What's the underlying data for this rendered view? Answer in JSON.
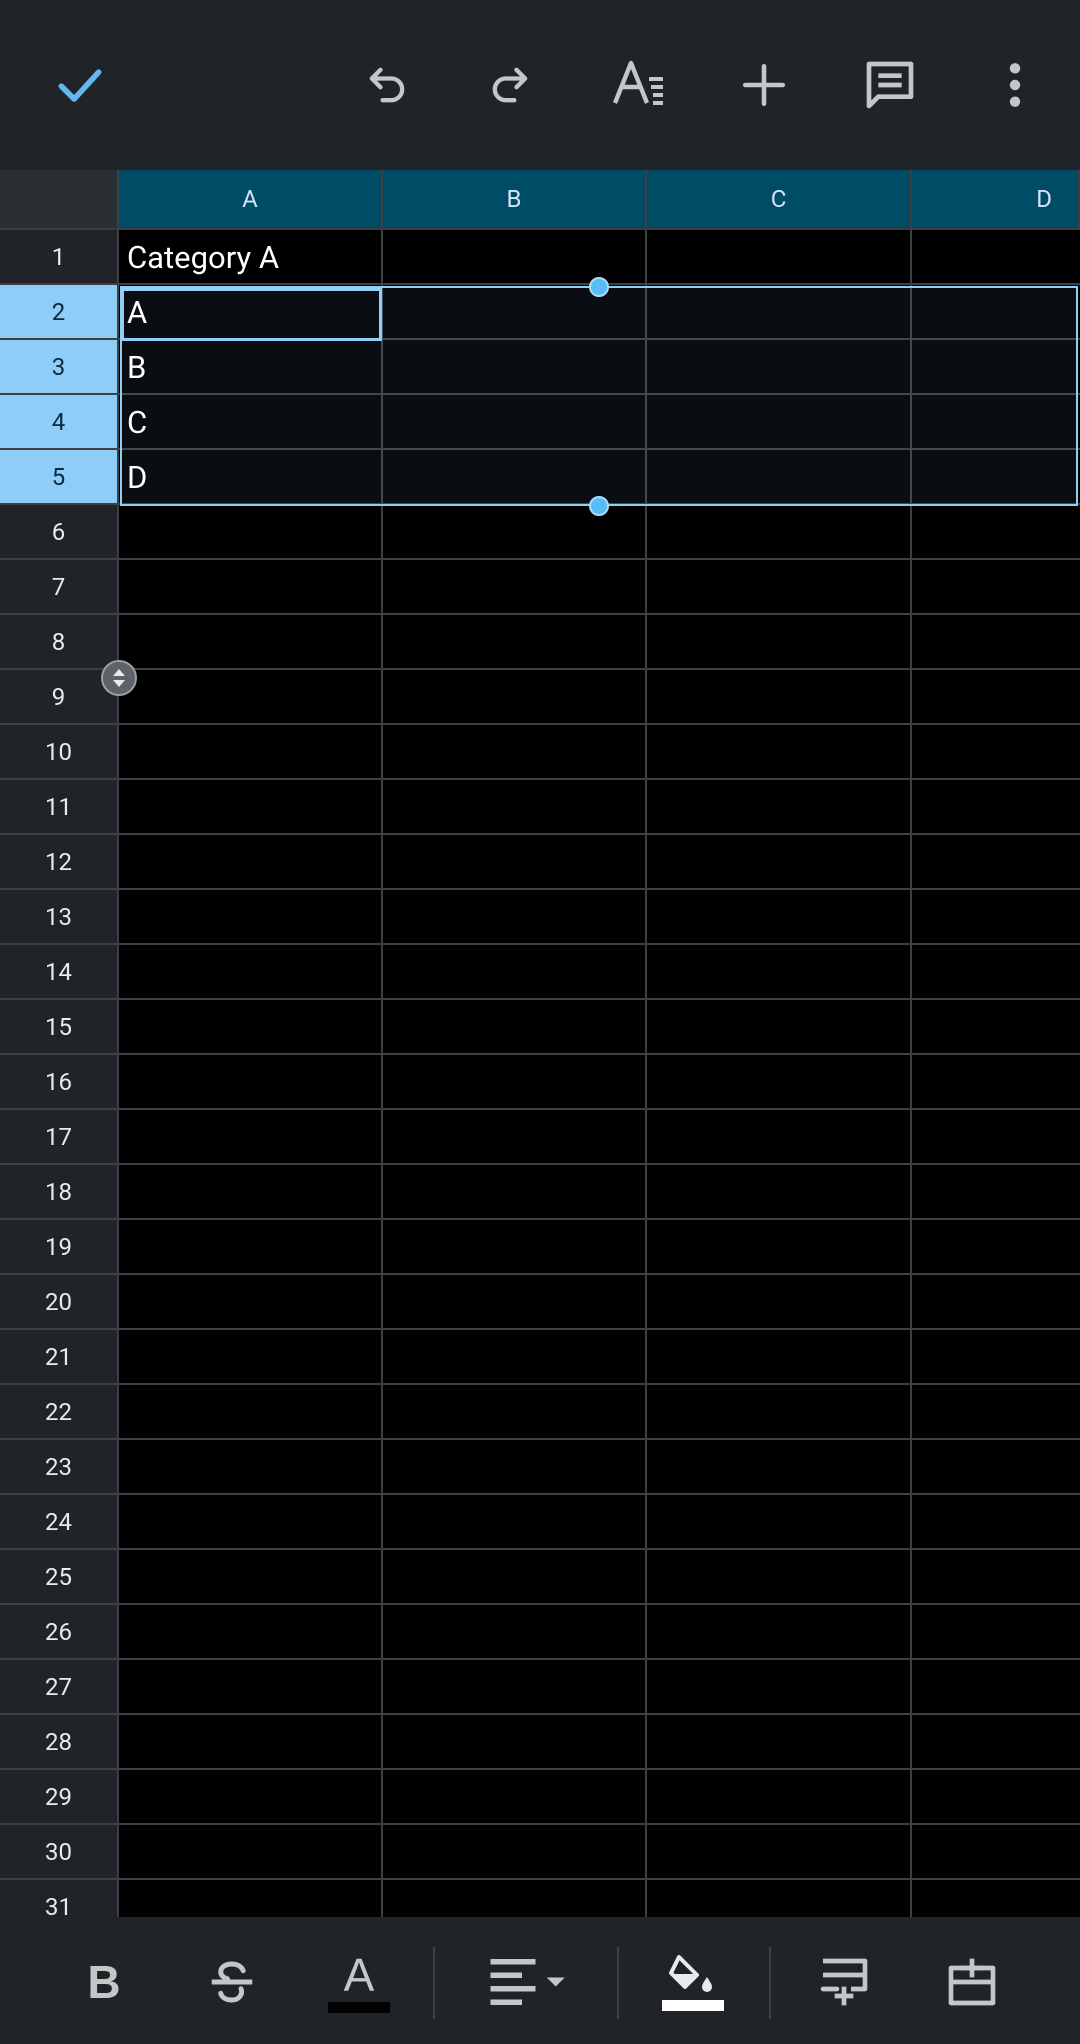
{
  "toolbar": {
    "confirm_icon": "check-icon",
    "undo_icon": "undo-icon",
    "redo_icon": "redo-icon",
    "format_icon": "text-format-icon",
    "insert_icon": "plus-icon",
    "comment_icon": "comment-icon",
    "more_icon": "more-vert-icon"
  },
  "columns": [
    "A",
    "B",
    "C",
    "D"
  ],
  "rows": [
    "1",
    "2",
    "3",
    "4",
    "5",
    "6",
    "7",
    "8",
    "9",
    "10",
    "11",
    "12",
    "13",
    "14",
    "15",
    "16",
    "17",
    "18",
    "19",
    "20",
    "21",
    "22",
    "23",
    "24",
    "25",
    "26",
    "27",
    "28",
    "29",
    "30",
    "31"
  ],
  "cells": {
    "A1": "Category A",
    "A2": "A",
    "A3": "B",
    "A4": "C",
    "A5": "D"
  },
  "selection": {
    "range": "A2:D5",
    "active_cell": "A2"
  },
  "format_bar": {
    "bold_label": "B",
    "strikethrough_icon": "strikethrough-icon",
    "text_color_label": "A",
    "text_color": "#000000",
    "align_icon": "align-left-icon",
    "fill_icon": "fill-color-icon",
    "fill_color": "#ffffff",
    "insert_row_icon": "insert-row-icon",
    "insert_column_icon": "insert-column-icon"
  },
  "colors": {
    "accent": "#8fd0f7",
    "header_bg": "#004b66",
    "toolbar_bg": "#202429"
  }
}
